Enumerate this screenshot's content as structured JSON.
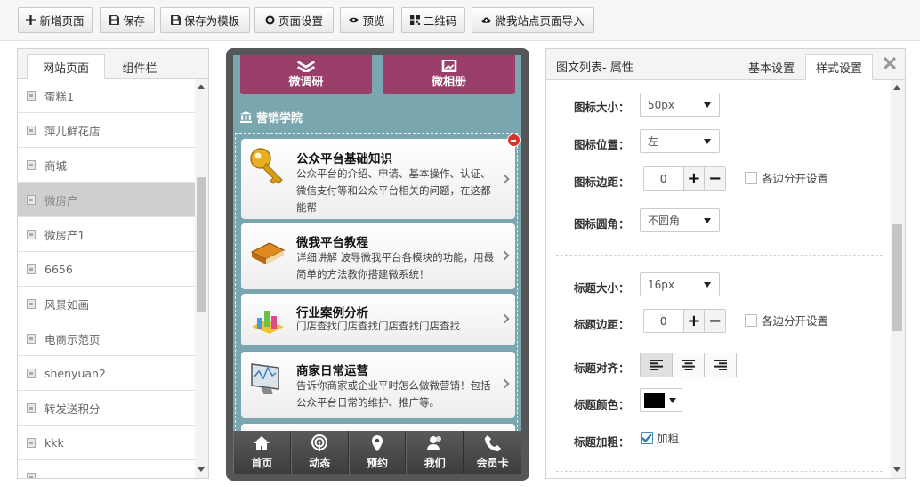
{
  "toolbar": {
    "buttons": [
      {
        "label": "新增页面",
        "icon": "plus-icon"
      },
      {
        "label": "保存",
        "icon": "save-icon"
      },
      {
        "label": "保存为模板",
        "icon": "save-template-icon"
      },
      {
        "label": "页面设置",
        "icon": "gear-icon"
      },
      {
        "label": "预览",
        "icon": "eye-icon"
      },
      {
        "label": "二维码",
        "icon": "qrcode-icon"
      },
      {
        "label": "微我站点页面导入",
        "icon": "cloud-import-icon"
      }
    ]
  },
  "left_panel": {
    "tabs": [
      "网站页面",
      "组件栏"
    ],
    "active_tab": "网站页面",
    "pages": [
      "蛋糕1",
      "萍儿鲜花店",
      "商城",
      "微房产",
      "微房产1",
      "6656",
      "风景如画",
      "电商示范页",
      "shenyuan2",
      "转发送积分",
      "kkk",
      ""
    ],
    "selected_page": "微房产"
  },
  "phone": {
    "top_tiles": [
      {
        "label": "微调研",
        "icon": "layers-icon"
      },
      {
        "label": "微相册",
        "icon": "photo-icon"
      }
    ],
    "section_title": "营销学院",
    "cards": [
      {
        "title": "公众平台基础知识",
        "desc": "公众平台的介绍、申请、基本操作、认证、微信支付等和公众平台相关的问题，在这都能帮",
        "icon": "key-icon"
      },
      {
        "title": "微我平台教程",
        "desc": "详细讲解 波导微我平台各模块的功能，用最简单的方法教你搭建微系统！",
        "icon": "book-icon"
      },
      {
        "title": "行业案例分析",
        "desc": "门店查找门店查找门店查找门店查找",
        "icon": "chart-blocks-icon"
      },
      {
        "title": "商家日常运营",
        "desc": "告诉你商家或企业平时怎么做微营销！包括公众平台日常的维护、推广等。",
        "icon": "monitor-icon"
      }
    ],
    "nav": [
      {
        "label": "首页",
        "icon": "home-icon"
      },
      {
        "label": "动态",
        "icon": "broadcast-icon"
      },
      {
        "label": "预约",
        "icon": "location-pin-icon"
      },
      {
        "label": "我们",
        "icon": "users-icon"
      },
      {
        "label": "会员卡",
        "icon": "phone-icon"
      }
    ]
  },
  "right_panel": {
    "title": "图文列表- 属性",
    "tabs": [
      "基本设置",
      "样式设置"
    ],
    "active_tab": "样式设置",
    "icon_size": {
      "label": "图标大小：",
      "value": "50px"
    },
    "icon_position": {
      "label": "图标位置：",
      "value": "左"
    },
    "icon_margin": {
      "label": "图标边距：",
      "value": "0",
      "check_label": "各边分开设置"
    },
    "icon_radius": {
      "label": "图标圆角：",
      "value": "不圆角"
    },
    "title_size": {
      "label": "标题大小：",
      "value": "16px"
    },
    "title_margin": {
      "label": "标题边距：",
      "value": "0",
      "check_label": "各边分开设置"
    },
    "title_align": {
      "label": "标题对齐：",
      "options": [
        "left",
        "center",
        "right"
      ],
      "selected": "left"
    },
    "title_color": {
      "label": "标题颜色：",
      "value": "#000000"
    },
    "title_bold": {
      "label": "标题加粗：",
      "check_label": "加粗",
      "checked": true
    }
  },
  "colors": {
    "phone_bg": "#7aa6b0",
    "tile_color": "#9a3f6a",
    "delete_badge": "#d9342b"
  }
}
